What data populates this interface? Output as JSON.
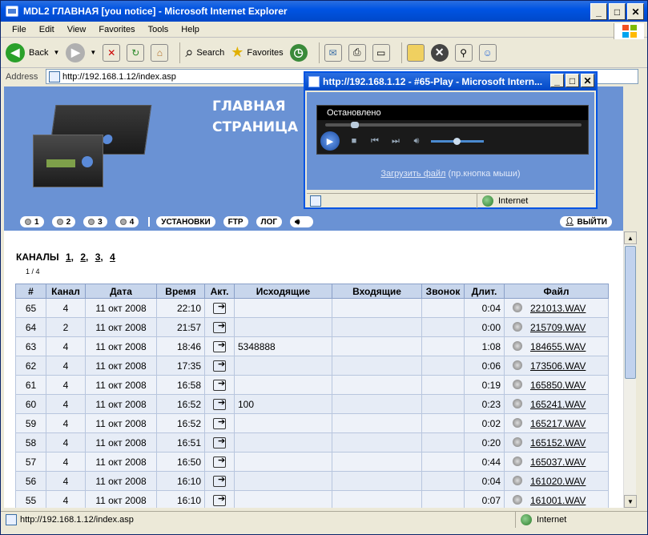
{
  "window": {
    "title": "MDL2 ГЛАВНАЯ [you notice] - Microsoft Internet Explorer",
    "minimize": "_",
    "maximize": "□",
    "close": "✕"
  },
  "menu": [
    "File",
    "Edit",
    "View",
    "Favorites",
    "Tools",
    "Help"
  ],
  "toolbar": {
    "back_label": "Back",
    "search_label": "Search",
    "favorites_label": "Favorites"
  },
  "address": {
    "label": "Address",
    "url": "http://192.168.1.12/index.asp"
  },
  "banner": {
    "title_line1": "ГЛАВНАЯ",
    "title_line2": "СТРАНИЦА"
  },
  "nav": {
    "channel_buttons": [
      "1",
      "2",
      "3",
      "4"
    ],
    "settings": "УСТАНОВКИ",
    "ftp": "FTP",
    "log": "ЛОГ",
    "logout": "ВЫЙТИ"
  },
  "channels": {
    "label": "КАНАЛЫ",
    "links": [
      "1",
      "2",
      "3",
      "4"
    ],
    "separator": ",",
    "page_info": "1 / 4"
  },
  "table": {
    "headers": [
      "#",
      "Канал",
      "Дата",
      "Время",
      "Акт.",
      "Исходящие",
      "Входящие",
      "Звонок",
      "Длит.",
      "Файл"
    ],
    "rows": [
      {
        "num": "65",
        "channel": "4",
        "date": "11 окт 2008",
        "time": "22:10",
        "outgoing": "",
        "incoming": "",
        "call": "",
        "duration": "0:04",
        "file": "221013.WAV"
      },
      {
        "num": "64",
        "channel": "2",
        "date": "11 окт 2008",
        "time": "21:57",
        "outgoing": "",
        "incoming": "",
        "call": "",
        "duration": "0:00",
        "file": "215709.WAV"
      },
      {
        "num": "63",
        "channel": "4",
        "date": "11 окт 2008",
        "time": "18:46",
        "outgoing": "5348888",
        "incoming": "",
        "call": "",
        "duration": "1:08",
        "file": "184655.WAV"
      },
      {
        "num": "62",
        "channel": "4",
        "date": "11 окт 2008",
        "time": "17:35",
        "outgoing": "",
        "incoming": "",
        "call": "",
        "duration": "0:06",
        "file": "173506.WAV"
      },
      {
        "num": "61",
        "channel": "4",
        "date": "11 окт 2008",
        "time": "16:58",
        "outgoing": "",
        "incoming": "",
        "call": "",
        "duration": "0:19",
        "file": "165850.WAV"
      },
      {
        "num": "60",
        "channel": "4",
        "date": "11 окт 2008",
        "time": "16:52",
        "outgoing": "100",
        "incoming": "",
        "call": "",
        "duration": "0:23",
        "file": "165241.WAV"
      },
      {
        "num": "59",
        "channel": "4",
        "date": "11 окт 2008",
        "time": "16:52",
        "outgoing": "",
        "incoming": "",
        "call": "",
        "duration": "0:02",
        "file": "165217.WAV"
      },
      {
        "num": "58",
        "channel": "4",
        "date": "11 окт 2008",
        "time": "16:51",
        "outgoing": "",
        "incoming": "",
        "call": "",
        "duration": "0:20",
        "file": "165152.WAV"
      },
      {
        "num": "57",
        "channel": "4",
        "date": "11 окт 2008",
        "time": "16:50",
        "outgoing": "",
        "incoming": "",
        "call": "",
        "duration": "0:44",
        "file": "165037.WAV"
      },
      {
        "num": "56",
        "channel": "4",
        "date": "11 окт 2008",
        "time": "16:10",
        "outgoing": "",
        "incoming": "",
        "call": "",
        "duration": "0:04",
        "file": "161020.WAV"
      },
      {
        "num": "55",
        "channel": "4",
        "date": "11 окт 2008",
        "time": "16:10",
        "outgoing": "",
        "incoming": "",
        "call": "",
        "duration": "0:07",
        "file": "161001.WAV"
      }
    ]
  },
  "statusbar": {
    "url": "http://192.168.1.12/index.asp",
    "zone": "Internet"
  },
  "popup": {
    "title": "http://192.168.1.12 - #65-Play - Microsoft Intern...",
    "player_status": "Остановлено",
    "download_link": "Загрузить файл",
    "download_hint": "(пр.кнопка мыши)",
    "zone": "Internet"
  }
}
